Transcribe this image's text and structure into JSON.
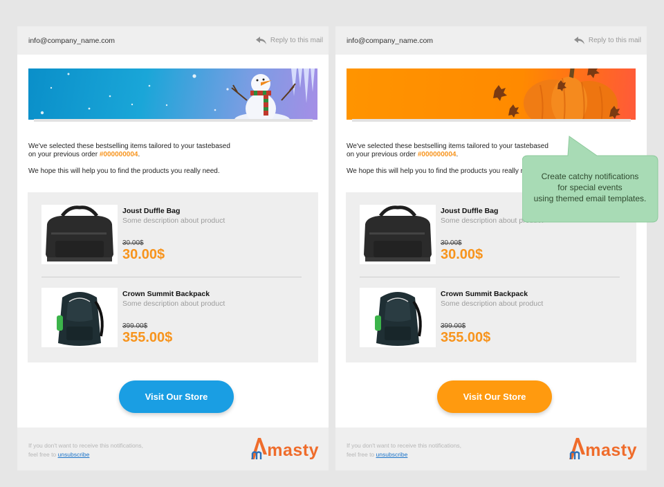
{
  "emails": [
    {
      "sender": "info@company_name.com",
      "reply_label": "Reply to this mail",
      "intro_line1": "We've selected these bestselling items tailored to your tastebased",
      "intro_line2_prefix": "on your previous order ",
      "order_number": "#000000004",
      "intro_line2_suffix": ".",
      "intro_paragraph2": "We hope this will help you to find the products you really need.",
      "products": [
        {
          "name": "Joust Duffle Bag",
          "description": "Some description about product",
          "old_price": "30.00$",
          "price": "30.00$"
        },
        {
          "name": "Crown Summit Backpack",
          "description": "Some description about product",
          "old_price": "399.00$",
          "price": "355.00$"
        }
      ],
      "cta_label": "Visit Our Store",
      "cta_color": "#1a9ee3",
      "footer_line1": "If you don't want to receive this notifications,",
      "footer_line2_prefix": "feel free to ",
      "unsubscribe_label": "unsubscribe",
      "logo_text": "masty",
      "banner_theme": "winter-snowman"
    },
    {
      "sender": "info@company_name.com",
      "reply_label": "Reply to this mail",
      "intro_line1": "We've selected these bestselling items tailored to your tastebased",
      "intro_line2_prefix": "on your previous order ",
      "order_number": "#000000004",
      "intro_line2_suffix": ".",
      "intro_paragraph2": "We hope this will help you to find the products you really need.",
      "products": [
        {
          "name": "Joust Duffle Bag",
          "description": "Some description about product",
          "old_price": "30.00$",
          "price": "30.00$"
        },
        {
          "name": "Crown Summit Backpack",
          "description": "Some description about product",
          "old_price": "399.00$",
          "price": "355.00$"
        }
      ],
      "cta_label": "Visit Our Store",
      "cta_color": "#ff9a0f",
      "footer_line1": "If you don't want to receive this notifications,",
      "footer_line2_prefix": "feel free to ",
      "unsubscribe_label": "unsubscribe",
      "logo_text": "masty",
      "banner_theme": "autumn-pumpkin"
    }
  ],
  "callout": {
    "line1": "Create catchy notifications",
    "line2": "for special events",
    "line3": "using themed email templates."
  },
  "colors": {
    "accent_orange": "#f7941d",
    "link_blue": "#1a73c9",
    "logo_orange": "#ef6c2b",
    "callout_green": "#a8dbb5"
  }
}
